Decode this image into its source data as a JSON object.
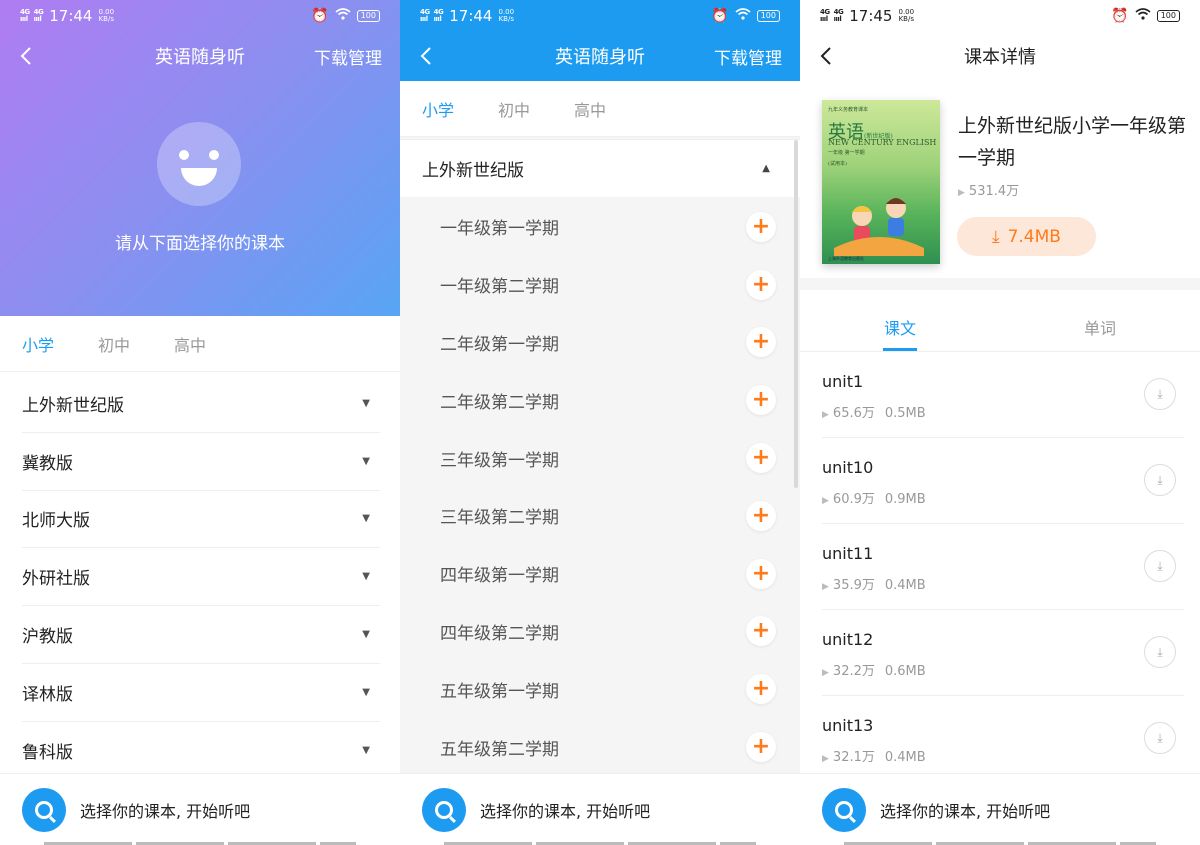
{
  "status_bars": [
    {
      "network": "4GHD 4GHD",
      "time": "17:44",
      "speed": "0.00\nKB/s",
      "battery": "100"
    },
    {
      "network": "4GHD 4GHD",
      "time": "17:44",
      "speed": "0.00\nKB/s",
      "battery": "100"
    },
    {
      "network": "4GHD 4GHD",
      "time": "17:45",
      "speed": "0.00\nKB/s",
      "battery": "100"
    }
  ],
  "screen1": {
    "title": "英语随身听",
    "manage_label": "下载管理",
    "hero_text": "请从下面选择你的课本",
    "levels": [
      "小学",
      "初中",
      "高中"
    ],
    "active_level": "小学",
    "books": [
      "上外新世纪版",
      "冀教版",
      "北师大版",
      "外研社版",
      "沪教版",
      "译林版",
      "鲁科版"
    ],
    "bottom_text": "选择你的课本, 开始听吧"
  },
  "screen2": {
    "title": "英语随身听",
    "manage_label": "下载管理",
    "levels": [
      "小学",
      "初中",
      "高中"
    ],
    "active_level": "小学",
    "expanded_version": "上外新世纪版",
    "terms": [
      "一年级第一学期",
      "一年级第二学期",
      "二年级第一学期",
      "二年级第二学期",
      "三年级第一学期",
      "三年级第二学期",
      "四年级第一学期",
      "四年级第二学期",
      "五年级第一学期",
      "五年级第二学期"
    ],
    "bottom_text": "选择你的课本, 开始听吧"
  },
  "screen3": {
    "title": "课本详情",
    "cover": {
      "publisher_top": "九年义务教育课本",
      "title": "英语",
      "edition": "(新世纪版)",
      "english_title": "NEW CENTURY ENGLISH",
      "grade": "一年级 第一学期",
      "trial": "(试用本)",
      "publisher_bottom": "上海外语教育出版社"
    },
    "book_title": "上外新世纪版小学一年级第一学期",
    "plays": "531.4万",
    "download_size": "7.4MB",
    "tabs": [
      "课文",
      "单词"
    ],
    "active_tab": "课文",
    "units": [
      {
        "name": "unit1",
        "plays": "65.6万",
        "size": "0.5MB"
      },
      {
        "name": "unit10",
        "plays": "60.9万",
        "size": "0.9MB"
      },
      {
        "name": "unit11",
        "plays": "35.9万",
        "size": "0.4MB"
      },
      {
        "name": "unit12",
        "plays": "32.2万",
        "size": "0.6MB"
      },
      {
        "name": "unit13",
        "plays": "32.1万",
        "size": "0.4MB"
      }
    ],
    "bottom_text": "选择你的课本, 开始听吧"
  },
  "colors": {
    "accent": "#1d9bf0",
    "orange": "#ff7a1a",
    "hero_start": "#b07cf2",
    "hero_end": "#58a5f4"
  }
}
